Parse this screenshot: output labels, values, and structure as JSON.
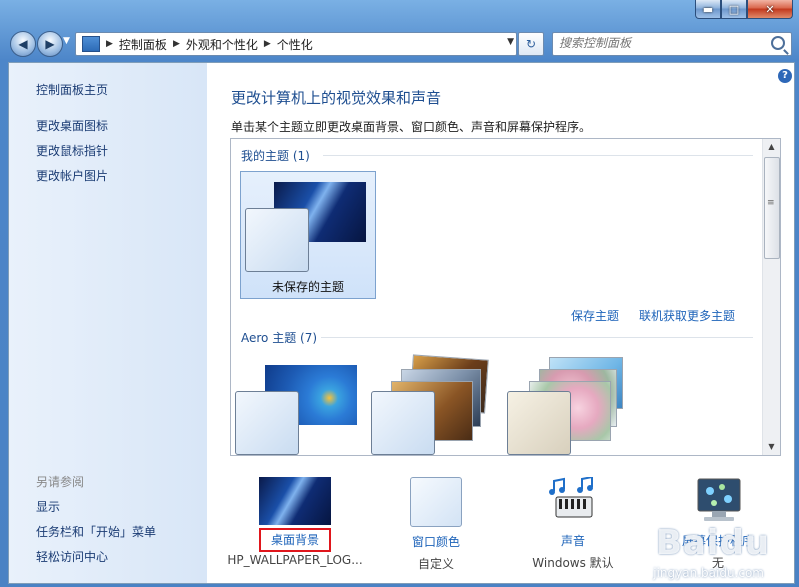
{
  "titlebar": {
    "min_glyph": "▬",
    "max_glyph": "□",
    "close_glyph": "✕"
  },
  "nav": {
    "back_glyph": "◀",
    "forward_glyph": "▶",
    "dropdown_glyph": "▼",
    "breadcrumb": [
      "控制面板",
      "外观和个性化",
      "个性化"
    ],
    "refresh_glyph": "↻"
  },
  "search": {
    "placeholder": "搜索控制面板"
  },
  "sidebar": {
    "home": "控制面板主页",
    "links": [
      "更改桌面图标",
      "更改鼠标指针",
      "更改帐户图片"
    ],
    "see_also_title": "另请参阅",
    "see_also": [
      "显示",
      "任务栏和「开始」菜单",
      "轻松访问中心"
    ]
  },
  "main": {
    "help_glyph": "?",
    "title": "更改计算机上的视觉效果和声音",
    "description": "单击某个主题立即更改桌面背景、窗口颜色、声音和屏幕保护程序。",
    "my_themes_title": "我的主题 (1)",
    "unsaved_theme_label": "未保存的主题",
    "save_theme_link": "保存主题",
    "get_more_link": "联机获取更多主题",
    "aero_title": "Aero 主题 (7)"
  },
  "options": [
    {
      "label": "桌面背景",
      "sub": "HP_WALLPAPER_LOG..."
    },
    {
      "label": "窗口颜色",
      "sub": "自定义"
    },
    {
      "label": "声音",
      "sub": "Windows 默认"
    },
    {
      "label": "屏幕保护程序",
      "sub": "无"
    }
  ],
  "watermark": {
    "brand": "Baidu",
    "sub": "jingyan.baidu.com"
  },
  "colors": {
    "accent": "#1e4e90",
    "link": "#1d63b9",
    "highlight_box": "#e0161c"
  }
}
